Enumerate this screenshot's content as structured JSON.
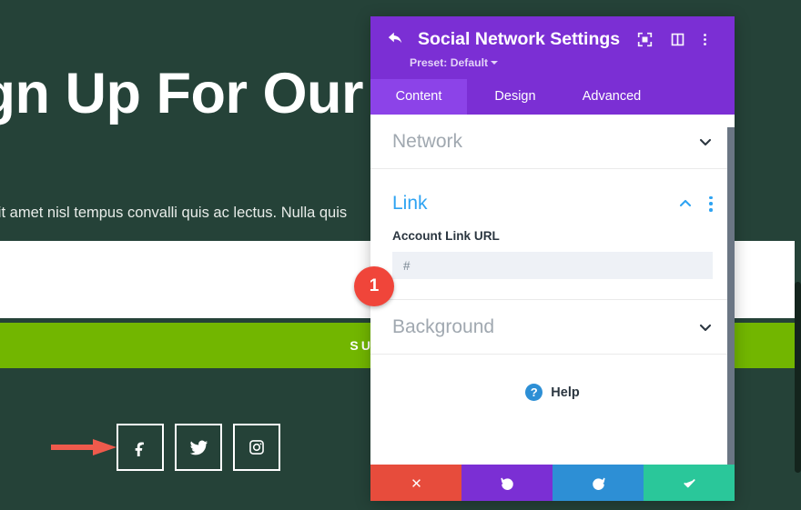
{
  "background_page": {
    "hero_title": "Sign Up For Our Newsletter",
    "hero_paragraph": "non nulla sit amet nisl tempus convalli quis ac lectus. Nulla quis",
    "subscribe_label": "SUBSCRIBE",
    "social_icons": [
      {
        "name": "facebook",
        "glyph": "f"
      },
      {
        "name": "twitter",
        "glyph": "twitter"
      },
      {
        "name": "instagram",
        "glyph": "instagram"
      }
    ],
    "colors": {
      "hero_background": "#254238",
      "subscribe_button": "#72b600",
      "annotation_arrow": "#ef5a4c"
    }
  },
  "modal": {
    "title": "Social Network Settings",
    "preset_label": "Preset: Default",
    "header_icons": [
      "focus-target-icon",
      "layout-panel-icon",
      "more-vertical-icon"
    ],
    "back_icon": "back-arrow-icon",
    "tabs": [
      {
        "label": "Content",
        "active": true
      },
      {
        "label": "Design",
        "active": false
      },
      {
        "label": "Advanced",
        "active": false
      }
    ],
    "sections": [
      {
        "title": "Network",
        "state": "collapsed"
      },
      {
        "title": "Link",
        "state": "expanded"
      },
      {
        "title": "Background",
        "state": "collapsed"
      }
    ],
    "link_section": {
      "field_label": "Account Link URL",
      "field_value": "#",
      "field_placeholder": "#"
    },
    "help": {
      "label": "Help",
      "badge": "?"
    },
    "footer_buttons": [
      {
        "name": "cancel",
        "icon": "close-x-icon",
        "color": "#e74c3c"
      },
      {
        "name": "undo",
        "icon": "undo-arrow-icon",
        "color": "#7b2fd4"
      },
      {
        "name": "redo",
        "icon": "redo-arrow-icon",
        "color": "#2d8fd5"
      },
      {
        "name": "save",
        "icon": "checkmark-icon",
        "color": "#2ac79a"
      }
    ],
    "colors": {
      "header": "#7b2fd4",
      "tab_active": "#8c43e8",
      "accent_blue": "#2ea3f2"
    }
  },
  "annotations": {
    "step_badge": "1"
  }
}
